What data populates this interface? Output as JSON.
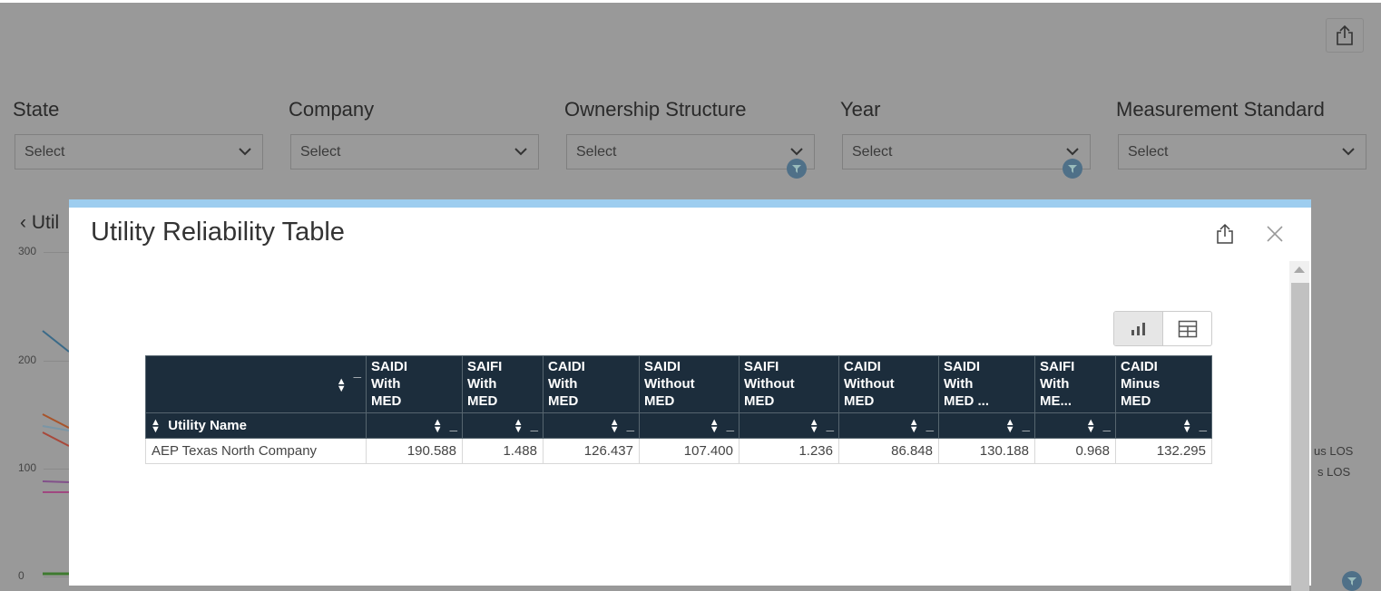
{
  "page": {
    "export_icon": "share-icon"
  },
  "filters": [
    {
      "label": "State",
      "value": "Select",
      "funnel": false
    },
    {
      "label": "Company",
      "value": "Select",
      "funnel": false
    },
    {
      "label": "Ownership Structure",
      "value": "Select",
      "funnel": true
    },
    {
      "label": "Year",
      "value": "Select",
      "funnel": true
    },
    {
      "label": "Measurement Standard",
      "value": "Select",
      "funnel": false
    }
  ],
  "background_chart": {
    "back_label": "Util",
    "y_ticks": [
      "300",
      "200",
      "100",
      "0"
    ],
    "legend_partial": [
      "us LOS",
      "s LOS"
    ]
  },
  "modal": {
    "title": "Utility Reliability Table",
    "accent": "#9dcdef",
    "header_bg": "#1c2d3c",
    "table": {
      "row_header": "Utility Name",
      "columns": [
        [
          "SAIDI",
          "With",
          "MED"
        ],
        [
          "SAIFI",
          "With",
          "MED"
        ],
        [
          "CAIDI",
          "With",
          "MED"
        ],
        [
          "SAIDI",
          "Without",
          "MED"
        ],
        [
          "SAIFI",
          "Without",
          "MED"
        ],
        [
          "CAIDI",
          "Without",
          "MED"
        ],
        [
          "SAIDI",
          "With",
          "MED ..."
        ],
        [
          "SAIFI",
          "With",
          "ME..."
        ],
        [
          "CAIDI",
          "Minus",
          "MED"
        ]
      ],
      "rows": [
        {
          "name": "AEP Texas North Company",
          "values": [
            "190.588",
            "1.488",
            "126.437",
            "107.400",
            "1.236",
            "86.848",
            "130.188",
            "0.968",
            "132.295"
          ]
        }
      ]
    }
  }
}
